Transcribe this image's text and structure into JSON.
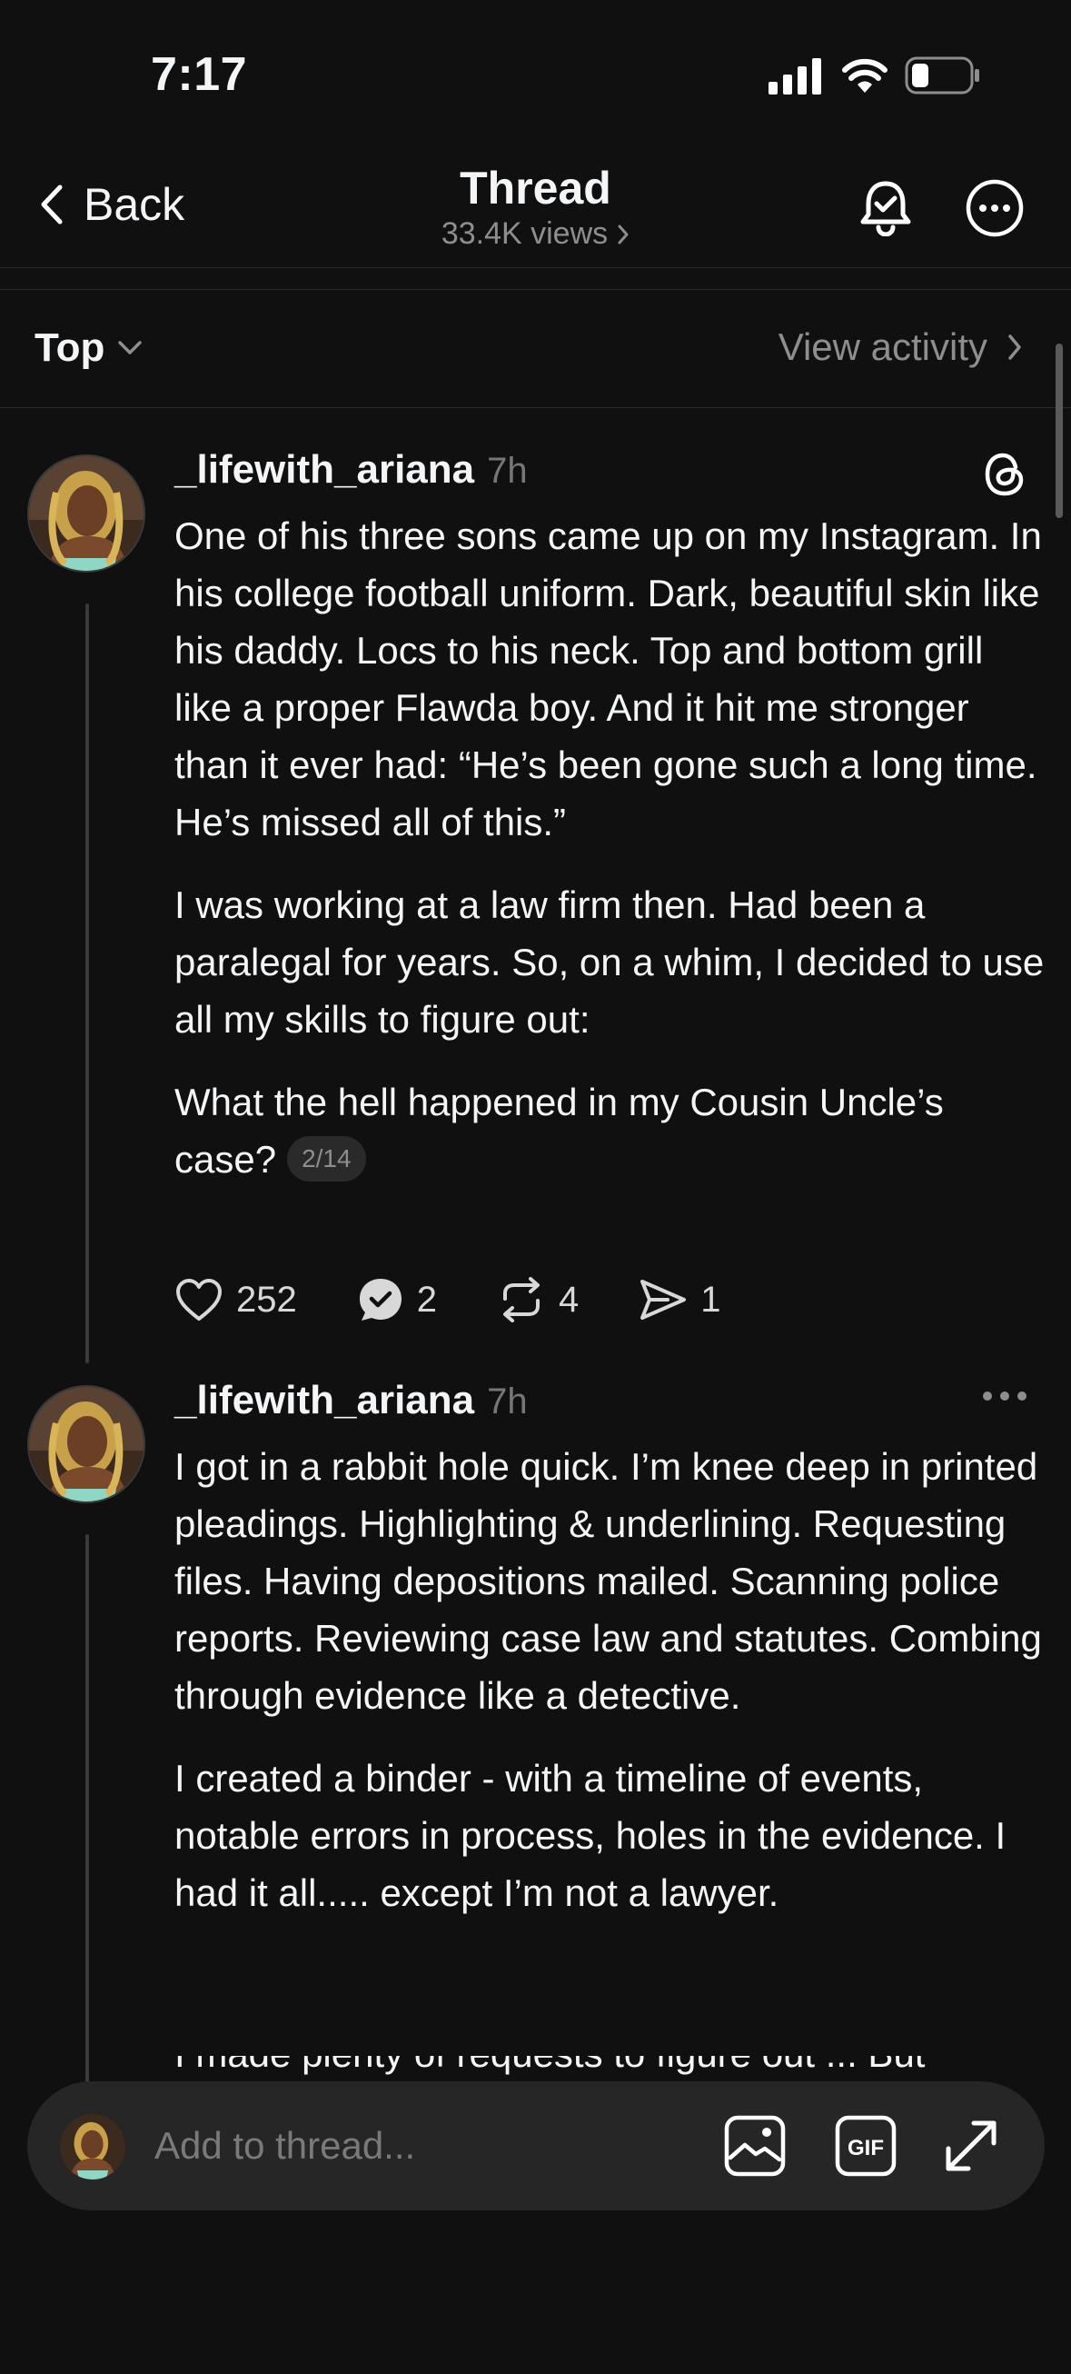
{
  "status_bar": {
    "time": "7:17"
  },
  "nav": {
    "back_label": "Back",
    "title": "Thread",
    "views": "33.4K views"
  },
  "sort": {
    "label": "Top",
    "activity_label": "View activity"
  },
  "posts": [
    {
      "username": "_lifewith_ariana",
      "time": "7h",
      "paragraphs": [
        "One of his three sons came up on my Instagram. In his college football uniform. Dark, beautiful skin like his daddy. Locs to his neck. Top and bottom grill like a proper Flawda boy. And it hit me stronger than it ever had: “He’s been gone such a long time. He’s missed all of this.”",
        "I was working at a law firm then. Had been a paralegal for years. So, on a whim, I decided to use all my skills to figure out:",
        "What the hell happened in my Cousin Uncle’s case?"
      ],
      "counter": "2/14",
      "likes": "252",
      "replies": "2",
      "reposts": "4",
      "shares": "1"
    },
    {
      "username": "_lifewith_ariana",
      "time": "7h",
      "paragraphs": [
        "I got in a rabbit hole quick. I’m knee deep in printed pleadings. Highlighting & underlining. Requesting files. Having depositions mailed. Scanning police reports. Reviewing case law and statutes. Combing through evidence like a detective.",
        "I created a binder - with a timeline of events, notable errors in process, holes in the evidence. I had it all..... except I’m not a lawyer."
      ],
      "peek_text": "I made plenty of requests to figure out ... But"
    }
  ],
  "composer": {
    "placeholder": "Add to thread...",
    "gif_label": "GIF"
  },
  "colors": {
    "background": "#101010",
    "text": "#f3f5f7",
    "muted": "#8e8e8e",
    "composer": "#262626"
  }
}
